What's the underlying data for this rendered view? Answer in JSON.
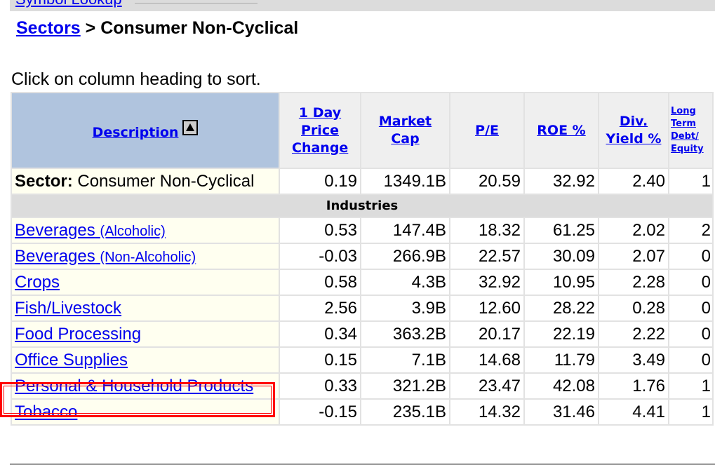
{
  "top_link": "Symbol Lookup",
  "breadcrumb": {
    "root": "Sectors",
    "separator": " > ",
    "current": "Consumer Non-Cyclical"
  },
  "hint": "Click on column heading to sort.",
  "columns": [
    "Description",
    "1 Day Price Change",
    "Market Cap",
    "P/E",
    "ROE %",
    "Div. Yield %",
    "Long Term Debt/ Equity"
  ],
  "sort": {
    "column": "Description",
    "direction": "ascending",
    "icon": "sort-up-icon"
  },
  "sector": {
    "label": "Sector:",
    "name": "Consumer Non-Cyclical",
    "values": [
      "0.19",
      "1349.1B",
      "20.59",
      "32.92",
      "2.40",
      "1"
    ]
  },
  "industries_label": "Industries",
  "rows": [
    {
      "name": "Beverages",
      "sub": "(Alcoholic)",
      "values": [
        "0.53",
        "147.4B",
        "18.32",
        "61.25",
        "2.02",
        "2"
      ]
    },
    {
      "name": "Beverages",
      "sub": "(Non-Alcoholic)",
      "values": [
        "-0.03",
        "266.9B",
        "22.57",
        "30.09",
        "2.07",
        "0"
      ]
    },
    {
      "name": "Crops",
      "sub": "",
      "values": [
        "0.58",
        "4.3B",
        "32.92",
        "10.95",
        "2.28",
        "0"
      ]
    },
    {
      "name": "Fish/Livestock",
      "sub": "",
      "values": [
        "2.56",
        "3.9B",
        "12.60",
        "28.22",
        "0.28",
        "0"
      ]
    },
    {
      "name": "Food Processing",
      "sub": "",
      "values": [
        "0.34",
        "363.2B",
        "20.17",
        "22.19",
        "2.22",
        "0"
      ]
    },
    {
      "name": "Office Supplies",
      "sub": "",
      "values": [
        "0.15",
        "7.1B",
        "14.68",
        "11.79",
        "3.49",
        "0"
      ]
    },
    {
      "name": "Personal & Household Products",
      "sub": "",
      "values": [
        "0.33",
        "321.2B",
        "23.47",
        "42.08",
        "1.76",
        "1"
      ]
    },
    {
      "name": "Tobacco",
      "sub": "",
      "values": [
        "-0.15",
        "235.1B",
        "14.32",
        "31.46",
        "4.41",
        "1"
      ]
    }
  ],
  "highlight_color": "#ff0000"
}
